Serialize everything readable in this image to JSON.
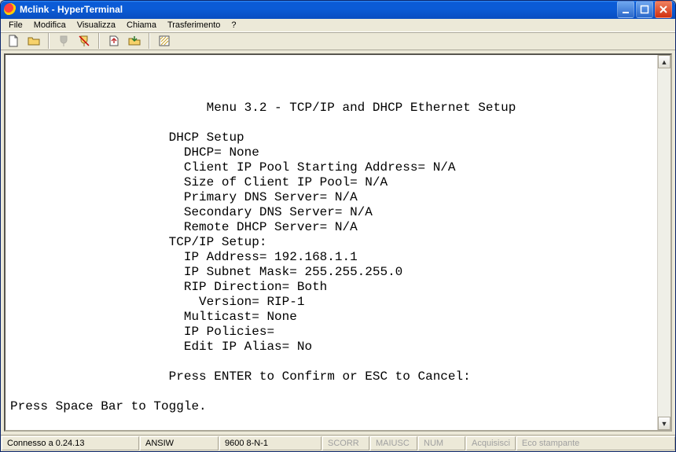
{
  "window": {
    "title": "Mclink - HyperTerminal"
  },
  "menubar": {
    "items": [
      "File",
      "Modifica",
      "Visualizza",
      "Chiama",
      "Trasferimento",
      "?"
    ]
  },
  "terminal": {
    "lines": [
      "",
      "",
      "                          Menu 3.2 - TCP/IP and DHCP Ethernet Setup",
      "",
      "                     DHCP Setup",
      "                       DHCP= None",
      "                       Client IP Pool Starting Address= N/A",
      "                       Size of Client IP Pool= N/A",
      "                       Primary DNS Server= N/A",
      "                       Secondary DNS Server= N/A",
      "                       Remote DHCP Server= N/A",
      "                     TCP/IP Setup:",
      "                       IP Address= 192.168.1.1",
      "                       IP Subnet Mask= 255.255.255.0",
      "                       RIP Direction= Both",
      "                         Version= RIP-1",
      "                       Multicast= None",
      "                       IP Policies=",
      "                       Edit IP Alias= No",
      "",
      "                     Press ENTER to Confirm or ESC to Cancel:",
      "",
      "Press Space Bar to Toggle."
    ]
  },
  "statusbar": {
    "connection": "Connesso a 0.24.13",
    "emulation": "ANSIW",
    "settings": "9600 8-N-1",
    "cells": [
      "SCORR",
      "MAIUSC",
      "NUM",
      "Acquisisci",
      "Eco stampante"
    ]
  }
}
